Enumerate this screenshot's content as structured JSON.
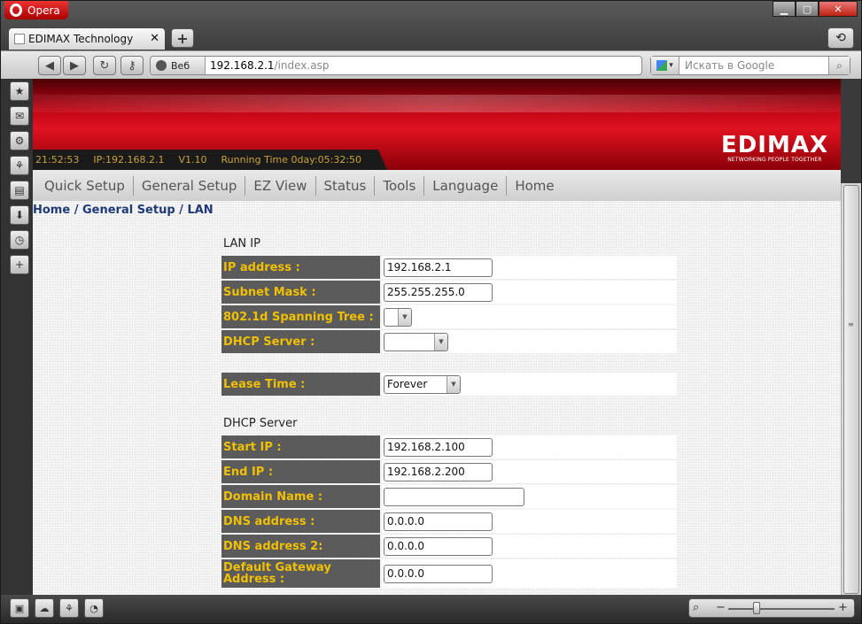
{
  "browser": {
    "app_name": "Opera",
    "tab_title": "EDIMAX Technology",
    "address": {
      "mode_label": "Веб",
      "host": "192.168.2.1",
      "path": "/index.asp"
    },
    "search_placeholder": "Искать в Google"
  },
  "router": {
    "status": {
      "time": "21:52:53",
      "ip": "IP:192.168.2.1",
      "version": "V1.10",
      "uptime": "Running Time 0day:05:32:50"
    },
    "logo": {
      "name": "EDIMAX",
      "tagline": "NETWORKING PEOPLE TOGETHER"
    },
    "menu": [
      "Quick Setup",
      "General Setup",
      "EZ View",
      "Status",
      "Tools",
      "Language",
      "Home"
    ],
    "breadcrumb": "Home / General Setup / LAN",
    "lan_ip": {
      "title": "LAN IP",
      "ip_label": "IP address :",
      "ip_value": "192.168.2.1",
      "mask_label": "Subnet Mask :",
      "mask_value": "255.255.255.0",
      "stp_label": "802.1d Spanning Tree :",
      "stp_value": "",
      "dhcp_label": "DHCP Server :",
      "dhcp_value": ""
    },
    "lease": {
      "label": "Lease Time :",
      "value": "Forever"
    },
    "dhcp": {
      "title": "DHCP Server",
      "start_label": "Start IP :",
      "start_value": "192.168.2.100",
      "end_label": "End IP :",
      "end_value": "192.168.2.200",
      "domain_label": "Domain Name :",
      "domain_value": "",
      "dns1_label": "DNS address :",
      "dns1_value": "0.0.0.0",
      "dns2_label": "DNS address 2:",
      "dns2_value": "0.0.0.0",
      "gw_label": "Default Gateway Address :",
      "gw_value": "0.0.0.0"
    }
  }
}
